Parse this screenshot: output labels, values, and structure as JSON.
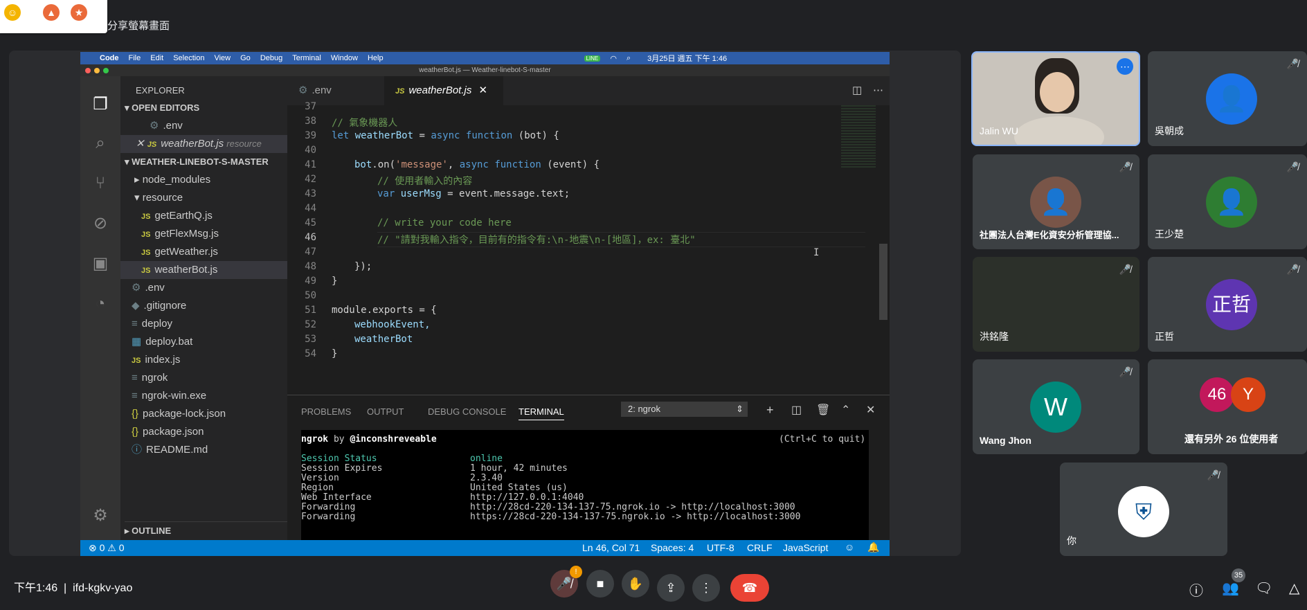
{
  "meet": {
    "share_label": "分享螢幕畫面",
    "time": "下午1:46",
    "meeting_code": "ifd-kgkv-yao",
    "people_count": "35",
    "end_call_color": "#ea4335"
  },
  "mac": {
    "apple": "",
    "menus": [
      "Code",
      "File",
      "Edit",
      "Selection",
      "View",
      "Go",
      "Debug",
      "Terminal",
      "Window",
      "Help"
    ],
    "clock": "3月25日 週五 下午 1:46"
  },
  "vscode": {
    "window_title": "weatherBot.js — Weather-linebot-S-master",
    "explorer": {
      "title": "EXPLORER",
      "open_editors": "OPEN EDITORS",
      "open_items": [
        {
          "name": ".env"
        },
        {
          "name": "weatherBot.js",
          "hint": "resource"
        }
      ],
      "project": "WEATHER-LINEBOT-S-MASTER",
      "files": [
        "node_modules",
        "resource",
        "getEarthQ.js",
        "getFlexMsg.js",
        "getWeather.js",
        "weatherBot.js",
        ".env",
        ".gitignore",
        "deploy",
        "deploy.bat",
        "index.js",
        "ngrok",
        "ngrok-win.exe",
        "package-lock.json",
        "package.json",
        "README.md"
      ],
      "outline": "OUTLINE"
    },
    "tabs": [
      ".env",
      "weatherBot.js"
    ],
    "line_numbers": [
      "37",
      "38",
      "39",
      "40",
      "41",
      "42",
      "43",
      "44",
      "45",
      "46",
      "47",
      "48",
      "49",
      "50",
      "51",
      "52",
      "53",
      "54"
    ],
    "code": {
      "l38": "// 氣象機器人",
      "l39_let": "let",
      "l39_name": "weatherBot",
      "l39_eq": " = ",
      "l39_async": "async",
      "l39_fn": "function",
      "l39_rest": " (bot) {",
      "l41_bot": "bot",
      "l41_on": ".on(",
      "l41_str": "'message'",
      "l41_comma": ", ",
      "l41_async": "async",
      "l41_fn": "function",
      "l41_rest": " (event) {",
      "l42": "// 使用者輸入的內容",
      "l43_var": "var",
      "l43_name": "userMsg",
      "l43_rest": " = event.message.text;",
      "l45": "// write your code here",
      "l46": "// \"請對我輸入指令，目前有的指令有:\\n-地震\\n-[地區]，ex: 臺北\"",
      "l48": "});",
      "l49": "}",
      "l51": "module.exports = {",
      "l52": "webhookEvent,",
      "l53": "weatherBot",
      "l54": "}"
    },
    "panel": {
      "tabs": [
        "PROBLEMS",
        "OUTPUT",
        "DEBUG CONSOLE",
        "TERMINAL"
      ],
      "selected": "2: ngrok"
    },
    "terminal": {
      "l1a": "ngrok",
      "l1b": " by ",
      "l1c": "@inconshreveable",
      "l1d": "(Ctrl+C to quit)",
      "rows": [
        [
          "Session Status",
          "online"
        ],
        [
          "Session Expires",
          "1 hour, 42 minutes"
        ],
        [
          "Version",
          "2.3.40"
        ],
        [
          "Region",
          "United States (us)"
        ],
        [
          "Web Interface",
          "http://127.0.0.1:4040"
        ],
        [
          "Forwarding",
          "http://28cd-220-134-137-75.ngrok.io -> http://localhost:3000"
        ],
        [
          "Forwarding",
          "https://28cd-220-134-137-75.ngrok.io -> http://localhost:3000"
        ]
      ]
    },
    "status": {
      "errors": "0",
      "warnings": "0",
      "pos": "Ln 46, Col 71",
      "spaces": "Spaces: 4",
      "enc": "UTF-8",
      "eol": "CRLF",
      "lang": "JavaScript"
    }
  },
  "participants": [
    {
      "name": "Jalin WU"
    },
    {
      "name": "吳朝成"
    },
    {
      "name": "社團法人台灣E化資安分析管理協..."
    },
    {
      "name": "王少楚"
    },
    {
      "name": "洪銘隆"
    },
    {
      "name": "正哲",
      "initials": "正哲"
    },
    {
      "name": "Wang Jhon",
      "initials": "W"
    },
    {
      "name": "還有另外 26 位使用者",
      "b1": "46",
      "b2": "Y"
    },
    {
      "name": "你"
    }
  ]
}
